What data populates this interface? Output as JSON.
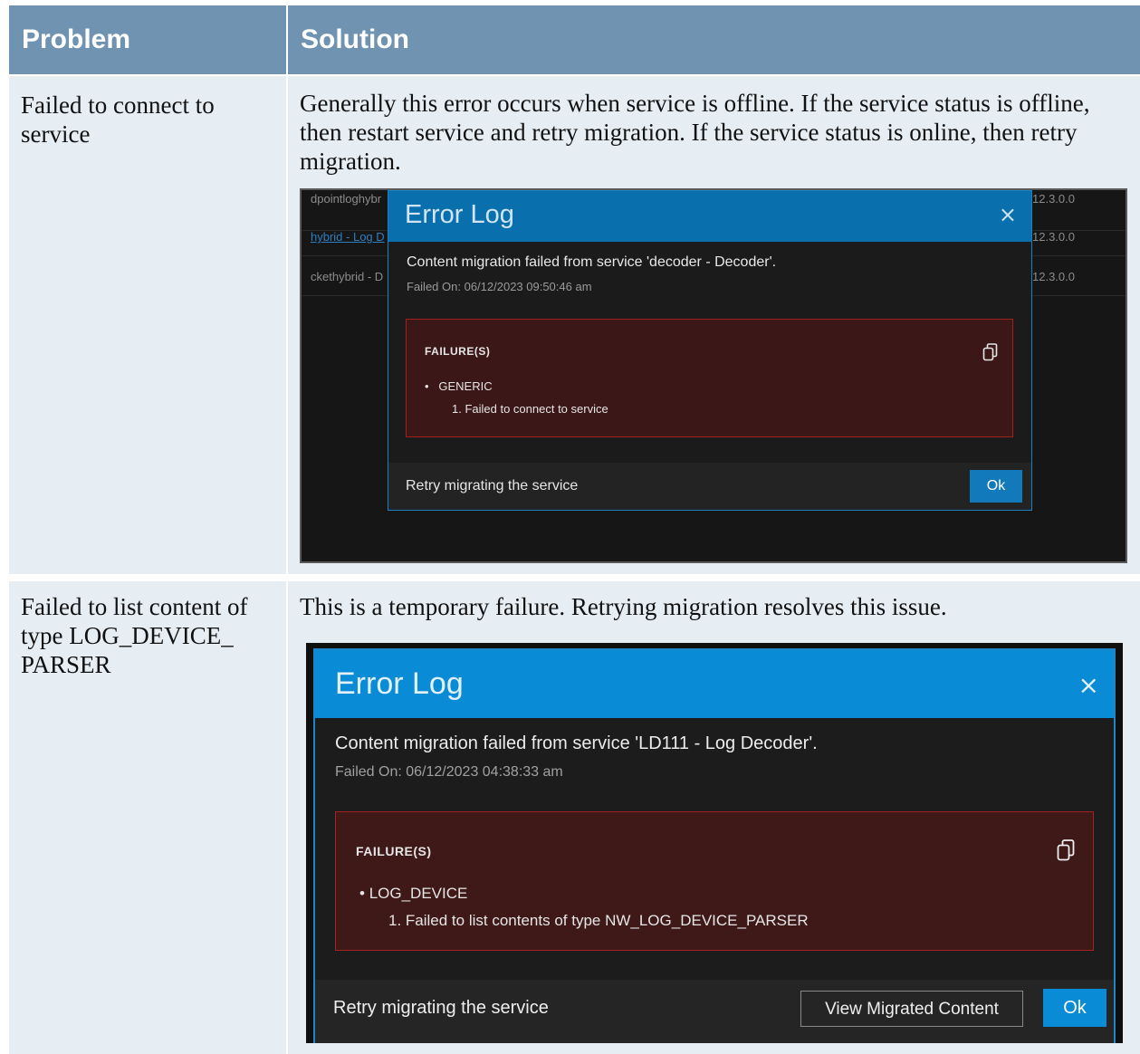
{
  "table": {
    "header_problem": "Problem",
    "header_solution": "Solution",
    "rows": [
      {
        "problem": "Failed to connect to service",
        "solution": "Generally this error occurs when service is offline. If the service status is offline, then restart service and retry migration. If the service status is online, then retry migration.",
        "screenshot": {
          "background_rows": [
            {
              "left": "dpointloghybr",
              "right": "12.3.0.0"
            },
            {
              "left": "hybrid - Log D",
              "right": "12.3.0.0"
            },
            {
              "left": "ckethybrid - D",
              "right": "12.3.0.0"
            }
          ],
          "dialog": {
            "title": "Error Log",
            "close_icon": "×",
            "message": "Content migration failed from service 'decoder - Decoder'.",
            "failed_on": "Failed On: 06/12/2023 09:50:46 am",
            "failures_label": "FAILURE(S)",
            "category": "GENERIC",
            "failure_item": "1.  Failed to connect to service",
            "footer_text": "Retry migrating the service",
            "ok_label": "Ok"
          }
        }
      },
      {
        "problem": "Failed to list content of type LOG_DEVICE_ PARSER",
        "solution": "This is a temporary failure. Retrying migration resolves this issue.",
        "screenshot": {
          "dialog": {
            "title": "Error Log",
            "close_icon": "×",
            "message": "Content migration failed from service 'LD111 - Log Decoder'.",
            "failed_on": "Failed On: 06/12/2023 04:38:33 am",
            "failures_label": "FAILURE(S)",
            "category": "LOG_DEVICE",
            "failure_item": "1.  Failed to list contents of type NW_LOG_DEVICE_PARSER",
            "footer_text": "Retry migrating the service",
            "view_migrated_label": "View Migrated Content",
            "ok_label": "Ok"
          }
        }
      }
    ]
  },
  "colors": {
    "header_bg": "#6f93b0",
    "cell_bg": "#e6eef4",
    "dialog_title_bg": "#0a8bd6",
    "failure_bg": "#3f1818",
    "failure_border": "#a52222",
    "ok_button": "#1279bb"
  },
  "icons": {
    "close": "close-icon",
    "copy": "copy-icon"
  }
}
